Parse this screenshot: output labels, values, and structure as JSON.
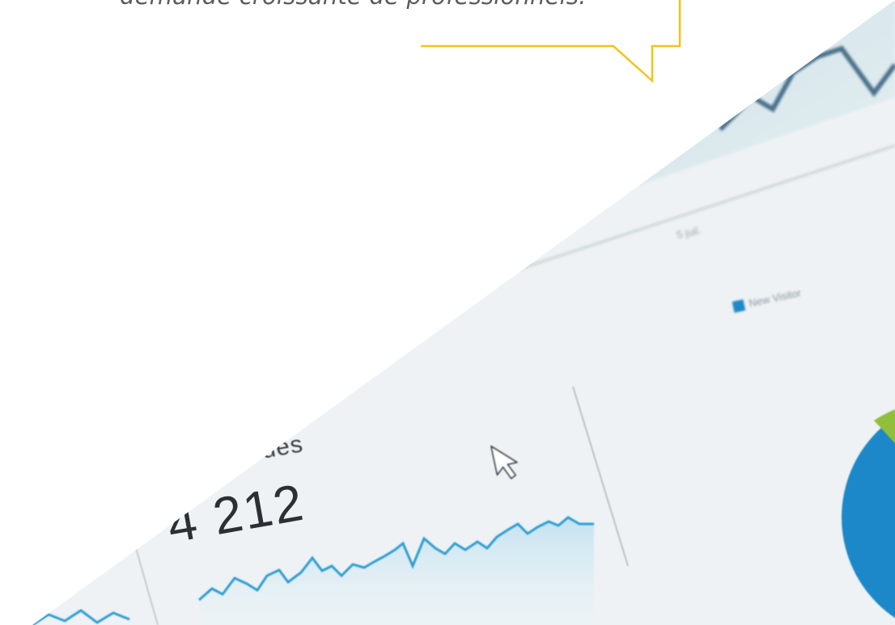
{
  "quote": {
    "text": "demande croissante de professionnels."
  },
  "dashboard": {
    "metric_label": "s vues",
    "metric_value": "4 212",
    "axis_blur_label": "5 juil.",
    "legend_label": "New Visitor",
    "accent_color": "#1e88c9",
    "pie_colors": [
      "#1e88c9",
      "#8fbf3a"
    ]
  }
}
